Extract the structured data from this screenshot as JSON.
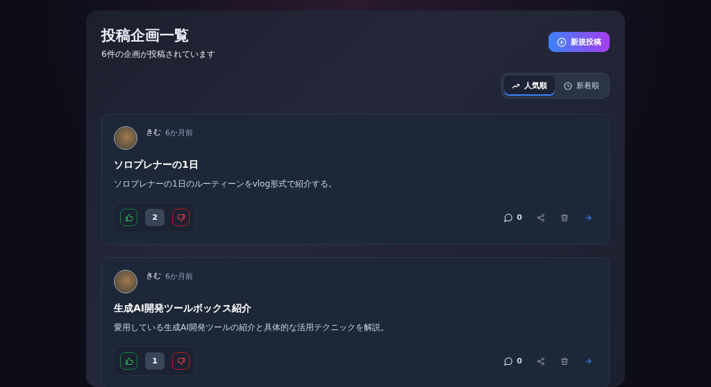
{
  "header": {
    "title": "投稿企画一覧",
    "subtitle": "6件の企画が投稿されています",
    "new_button": "新規投稿"
  },
  "sort_tabs": [
    {
      "label": "人気順",
      "kind": "trending",
      "selected": true
    },
    {
      "label": "新着順",
      "kind": "clock",
      "selected": false
    }
  ],
  "posts": [
    {
      "author": "きむ",
      "time": "6か月前",
      "title": "ソロプレナーの1日",
      "description": "ソロプレナーの1日のルーティーンをvlog形式で紹介する。",
      "votes": "2",
      "comments": "0"
    },
    {
      "author": "きむ",
      "time": "6か月前",
      "title": "生成AI開発ツールボックス紹介",
      "description": "愛用している生成AI開発ツールの紹介と具体的な活用テクニックを解説。",
      "votes": "1",
      "comments": "0"
    }
  ]
}
